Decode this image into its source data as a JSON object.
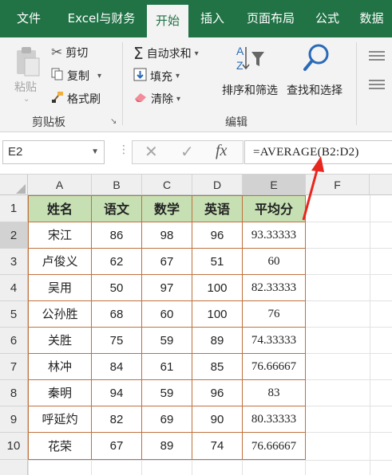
{
  "ribbon_tabs": [
    "文件",
    "Excel与财务",
    "开始",
    "插入",
    "页面布局",
    "公式",
    "数据"
  ],
  "active_tab": "开始",
  "clipboard": {
    "paste": "粘贴",
    "cut": "剪切",
    "copy": "复制",
    "format_painter": "格式刷",
    "group_label": "剪贴板"
  },
  "editing": {
    "autosum": "自动求和",
    "fill": "填充",
    "clear": "清除",
    "sort_filter": "排序和筛选",
    "find_select": "查找和选择",
    "group_label": "编辑"
  },
  "formula_bar": {
    "name_box": "E2",
    "formula": "=AVERAGE(B2:D2)"
  },
  "columns": [
    "A",
    "B",
    "C",
    "D",
    "E",
    "F"
  ],
  "rows": [
    "1",
    "2",
    "3",
    "4",
    "5",
    "6",
    "7",
    "8",
    "9",
    "10"
  ],
  "table": {
    "headers": [
      "姓名",
      "语文",
      "数学",
      "英语",
      "平均分"
    ],
    "rows": [
      [
        "宋江",
        "86",
        "98",
        "96",
        "93.33333"
      ],
      [
        "卢俊义",
        "62",
        "67",
        "51",
        "60"
      ],
      [
        "吴用",
        "50",
        "97",
        "100",
        "82.33333"
      ],
      [
        "公孙胜",
        "68",
        "60",
        "100",
        "76"
      ],
      [
        "关胜",
        "75",
        "59",
        "89",
        "74.33333"
      ],
      [
        "林冲",
        "84",
        "61",
        "85",
        "76.66667"
      ],
      [
        "秦明",
        "94",
        "59",
        "96",
        "83"
      ],
      [
        "呼延灼",
        "82",
        "69",
        "90",
        "80.33333"
      ],
      [
        "花荣",
        "67",
        "89",
        "74",
        "76.66667"
      ]
    ]
  },
  "colors": {
    "ribbon_green": "#217346",
    "header_fill": "#c6e0b4",
    "table_border": "#c0703c",
    "annotation_arrow": "#e8261d"
  }
}
